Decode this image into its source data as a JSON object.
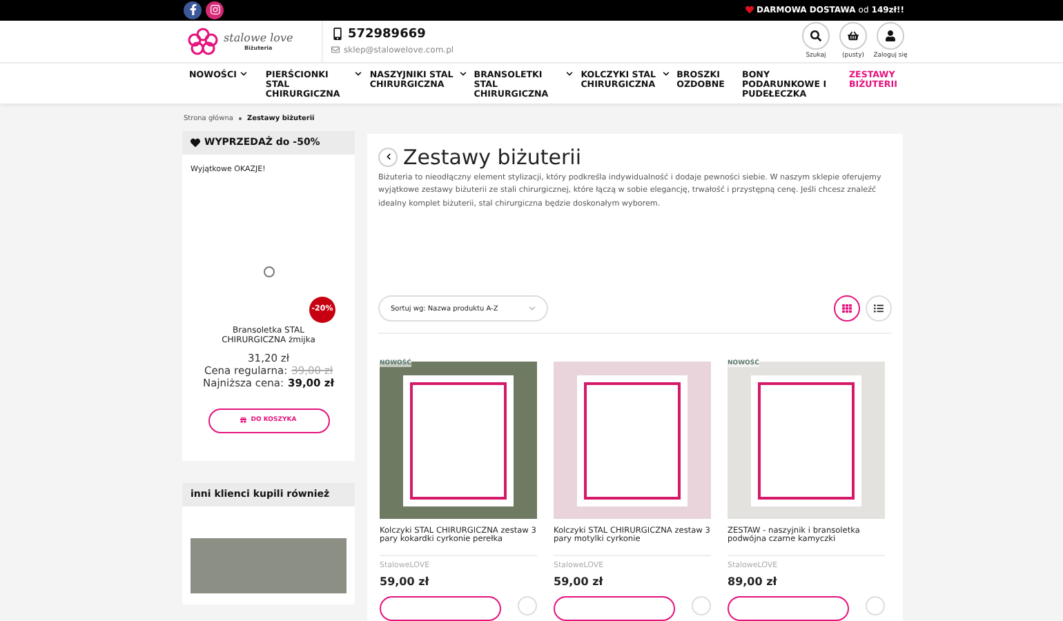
{
  "top_bar": {
    "shipping_bold": "DARMOWA DOSTAWA",
    "shipping_mid": "od",
    "shipping_amount": "149zł!!"
  },
  "header": {
    "logo_name": "stalowe love",
    "logo_sub": "Biżuteria",
    "phone": "572989669",
    "email": "sklep@stalowelove.com.pl",
    "actions": [
      {
        "kind": "search",
        "label": "Szukaj"
      },
      {
        "kind": "cart",
        "label": "(pusty)"
      },
      {
        "kind": "user",
        "label": "Zaloguj się"
      }
    ]
  },
  "nav": [
    {
      "label": "NOWOŚCI",
      "has_dropdown": true,
      "selected": false
    },
    {
      "label": "PIERŚCIONKI STAL CHIRURGICZNA",
      "has_dropdown": true,
      "selected": false
    },
    {
      "label": "NASZYJNIKI STAL CHIRURGICZNA",
      "has_dropdown": true,
      "selected": false
    },
    {
      "label": "BRANSOLETKI STAL CHIRURGICZNA",
      "has_dropdown": true,
      "selected": false
    },
    {
      "label": "KOLCZYKI STAL CHIRURGICZNA",
      "has_dropdown": true,
      "selected": false
    },
    {
      "label": "BROSZKI OZDOBNE",
      "has_dropdown": false,
      "selected": false
    },
    {
      "label": "BONY PODARUNKOWE I PUDEŁECZKA",
      "has_dropdown": false,
      "selected": false
    },
    {
      "label": "ZESTAWY BIŻUTERII",
      "has_dropdown": false,
      "selected": true
    }
  ],
  "breadcrumb": [
    "Strona główna",
    "Zestawy biżuterii"
  ],
  "sidebar": {
    "sale_title": "WYPRZEDAŻ do -50%",
    "sale_subtitle": "Wyjątkowe OKAZJE!",
    "badge": "-20%",
    "product_name": "Bransoletka STAL CHIRURGICZNA żmijka",
    "price": "31,20 zł",
    "regular_label": "Cena regularna:",
    "regular_price": "39,00 zł",
    "lowest_label": "Najniższa cena:",
    "lowest_price": "39,00 zł",
    "cart_button": "DO KOSZYKA",
    "others_title": "inni klienci kupili również"
  },
  "main": {
    "title": "Zestawy biżuterii",
    "description": "Biżuteria to nieodłączny element stylizacji, który podkreśla indywidualność i dodaje pewności siebie. W naszym sklepie oferujemy wyjątkowe zestawy biżuterii ze stali chirurgicznej, które łączą w sobie elegancję, trwałość i przystępną cenę. Jeśli chcesz znaleźć idealny komplet biżuterii, stal chirurgiczna będzie doskonałym wyborem.",
    "sort": "Sortuj wg: Nazwa produktu A-Z",
    "views": [
      {
        "kind": "grid",
        "selected": true
      },
      {
        "kind": "list",
        "selected": false
      }
    ],
    "products": [
      {
        "badge": "NOWOŚĆ",
        "name": "Kolczyki STAL CHIRURGICZNA zestaw 3 pary kokardki cyrkonie perełka",
        "brand": "StaloweLOVE",
        "price": "59,00 zł"
      },
      {
        "name": "Kolczyki STAL CHIRURGICZNA zestaw 3 pary motylki cyrkonie",
        "brand": "StaloweLOVE",
        "price": "59,00 zł"
      },
      {
        "badge": "NOWOŚĆ",
        "name": "ZESTAW - naszyjnik i bransoletka podwójna czarne kamyczki",
        "brand": "StaloweLOVE",
        "price": "89,00 zł"
      }
    ]
  }
}
